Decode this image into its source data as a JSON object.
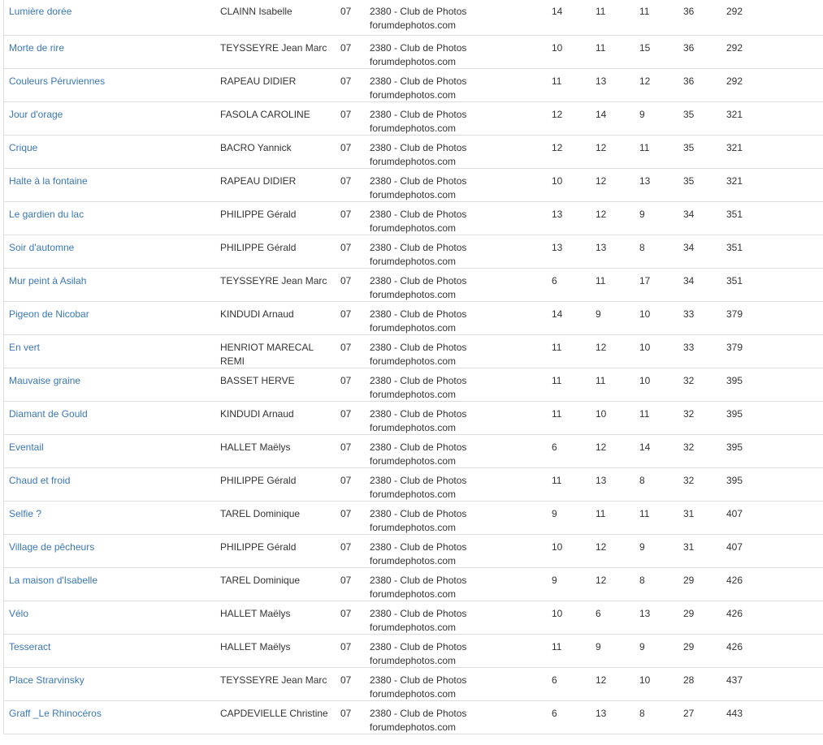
{
  "results": {
    "rows": [
      {
        "title": "Lumière dorée",
        "author": "CLAINN Isabelle",
        "region": "07",
        "club_line1": "2380 - Club de Photos",
        "club_line2": "forumdephotos.com",
        "n1": "14",
        "n2": "11",
        "n3": "11",
        "total": "36",
        "rank": "292"
      },
      {
        "title": "Morte de rire",
        "author": "TEYSSEYRE Jean Marc",
        "region": "07",
        "club_line1": "2380 - Club de Photos",
        "club_line2": "forumdephotos.com",
        "n1": "10",
        "n2": "11",
        "n3": "15",
        "total": "36",
        "rank": "292"
      },
      {
        "title": "Couleurs Péruviennes",
        "author": "RAPEAU DIDIER",
        "region": "07",
        "club_line1": "2380 - Club de Photos",
        "club_line2": "forumdephotos.com",
        "n1": "11",
        "n2": "13",
        "n3": "12",
        "total": "36",
        "rank": "292"
      },
      {
        "title": "Jour d'orage",
        "author": "FASOLA CAROLINE",
        "region": "07",
        "club_line1": "2380 - Club de Photos",
        "club_line2": "forumdephotos.com",
        "n1": "12",
        "n2": "14",
        "n3": "9",
        "total": "35",
        "rank": "321"
      },
      {
        "title": "Crique",
        "author": "BACRO Yannick",
        "region": "07",
        "club_line1": "2380 - Club de Photos",
        "club_line2": "forumdephotos.com",
        "n1": "12",
        "n2": "12",
        "n3": "11",
        "total": "35",
        "rank": "321"
      },
      {
        "title": "Halte à la fontaine",
        "author": "RAPEAU DIDIER",
        "region": "07",
        "club_line1": "2380 - Club de Photos",
        "club_line2": "forumdephotos.com",
        "n1": "10",
        "n2": "12",
        "n3": "13",
        "total": "35",
        "rank": "321"
      },
      {
        "title": "Le gardien du lac",
        "author": "PHILIPPE Gérald",
        "region": "07",
        "club_line1": "2380 - Club de Photos",
        "club_line2": "forumdephotos.com",
        "n1": "13",
        "n2": "12",
        "n3": "9",
        "total": "34",
        "rank": "351"
      },
      {
        "title": "Soir d'automne",
        "author": "PHILIPPE Gérald",
        "region": "07",
        "club_line1": "2380 - Club de Photos",
        "club_line2": "forumdephotos.com",
        "n1": "13",
        "n2": "13",
        "n3": "8",
        "total": "34",
        "rank": "351"
      },
      {
        "title": "Mur peint à Asilah",
        "author": "TEYSSEYRE Jean Marc",
        "region": "07",
        "club_line1": "2380 - Club de Photos",
        "club_line2": "forumdephotos.com",
        "n1": "6",
        "n2": "11",
        "n3": "17",
        "total": "34",
        "rank": "351"
      },
      {
        "title": "Pigeon de Nicobar",
        "author": "KINDUDI Arnaud",
        "region": "07",
        "club_line1": "2380 - Club de Photos",
        "club_line2": "forumdephotos.com",
        "n1": "14",
        "n2": "9",
        "n3": "10",
        "total": "33",
        "rank": "379"
      },
      {
        "title": "En vert",
        "author": "HENRIOT MARECAL REMI",
        "region": "07",
        "club_line1": "2380 - Club de Photos",
        "club_line2": "forumdephotos.com",
        "n1": "11",
        "n2": "12",
        "n3": "10",
        "total": "33",
        "rank": "379"
      },
      {
        "title": "Mauvaise graine",
        "author": "BASSET HERVE",
        "region": "07",
        "club_line1": "2380 - Club de Photos",
        "club_line2": "forumdephotos.com",
        "n1": "11",
        "n2": "11",
        "n3": "10",
        "total": "32",
        "rank": "395"
      },
      {
        "title": "Diamant de Gould",
        "author": "KINDUDI Arnaud",
        "region": "07",
        "club_line1": "2380 - Club de Photos",
        "club_line2": "forumdephotos.com",
        "n1": "11",
        "n2": "10",
        "n3": "11",
        "total": "32",
        "rank": "395"
      },
      {
        "title": "Eventail",
        "author": "HALLET Maëlys",
        "region": "07",
        "club_line1": "2380 - Club de Photos",
        "club_line2": "forumdephotos.com",
        "n1": "6",
        "n2": "12",
        "n3": "14",
        "total": "32",
        "rank": "395"
      },
      {
        "title": "Chaud et froid",
        "author": "PHILIPPE Gérald",
        "region": "07",
        "club_line1": "2380 - Club de Photos",
        "club_line2": "forumdephotos.com",
        "n1": "11",
        "n2": "13",
        "n3": "8",
        "total": "32",
        "rank": "395"
      },
      {
        "title": "Selfie ?",
        "author": "TAREL Dominique",
        "region": "07",
        "club_line1": "2380 - Club de Photos",
        "club_line2": "forumdephotos.com",
        "n1": "9",
        "n2": "11",
        "n3": "11",
        "total": "31",
        "rank": "407"
      },
      {
        "title": "Village de pêcheurs",
        "author": "PHILIPPE Gérald",
        "region": "07",
        "club_line1": "2380 - Club de Photos",
        "club_line2": "forumdephotos.com",
        "n1": "10",
        "n2": "12",
        "n3": "9",
        "total": "31",
        "rank": "407"
      },
      {
        "title": "La maison d'Isabelle",
        "author": "TAREL Dominique",
        "region": "07",
        "club_line1": "2380 - Club de Photos",
        "club_line2": "forumdephotos.com",
        "n1": "9",
        "n2": "12",
        "n3": "8",
        "total": "29",
        "rank": "426"
      },
      {
        "title": "Vélo",
        "author": "HALLET Maëlys",
        "region": "07",
        "club_line1": "2380 - Club de Photos",
        "club_line2": "forumdephotos.com",
        "n1": "10",
        "n2": "6",
        "n3": "13",
        "total": "29",
        "rank": "426"
      },
      {
        "title": "Tesseract",
        "author": "HALLET Maëlys",
        "region": "07",
        "club_line1": "2380 - Club de Photos",
        "club_line2": "forumdephotos.com",
        "n1": "11",
        "n2": "9",
        "n3": "9",
        "total": "29",
        "rank": "426"
      },
      {
        "title": "Place Strarvinsky",
        "author": "TEYSSEYRE Jean Marc",
        "region": "07",
        "club_line1": "2380 - Club de Photos",
        "club_line2": "forumdephotos.com",
        "n1": "6",
        "n2": "12",
        "n3": "10",
        "total": "28",
        "rank": "437"
      },
      {
        "title": "Graff _Le Rhinocéros",
        "author": "CAPDEVIELLE Christine",
        "region": "07",
        "club_line1": "2380 - Club de Photos",
        "club_line2": "forumdephotos.com",
        "n1": "6",
        "n2": "13",
        "n3": "8",
        "total": "27",
        "rank": "443"
      }
    ]
  },
  "colors": {
    "link": "#3a77b5",
    "text": "#333333",
    "row_border": "#dddddd"
  }
}
